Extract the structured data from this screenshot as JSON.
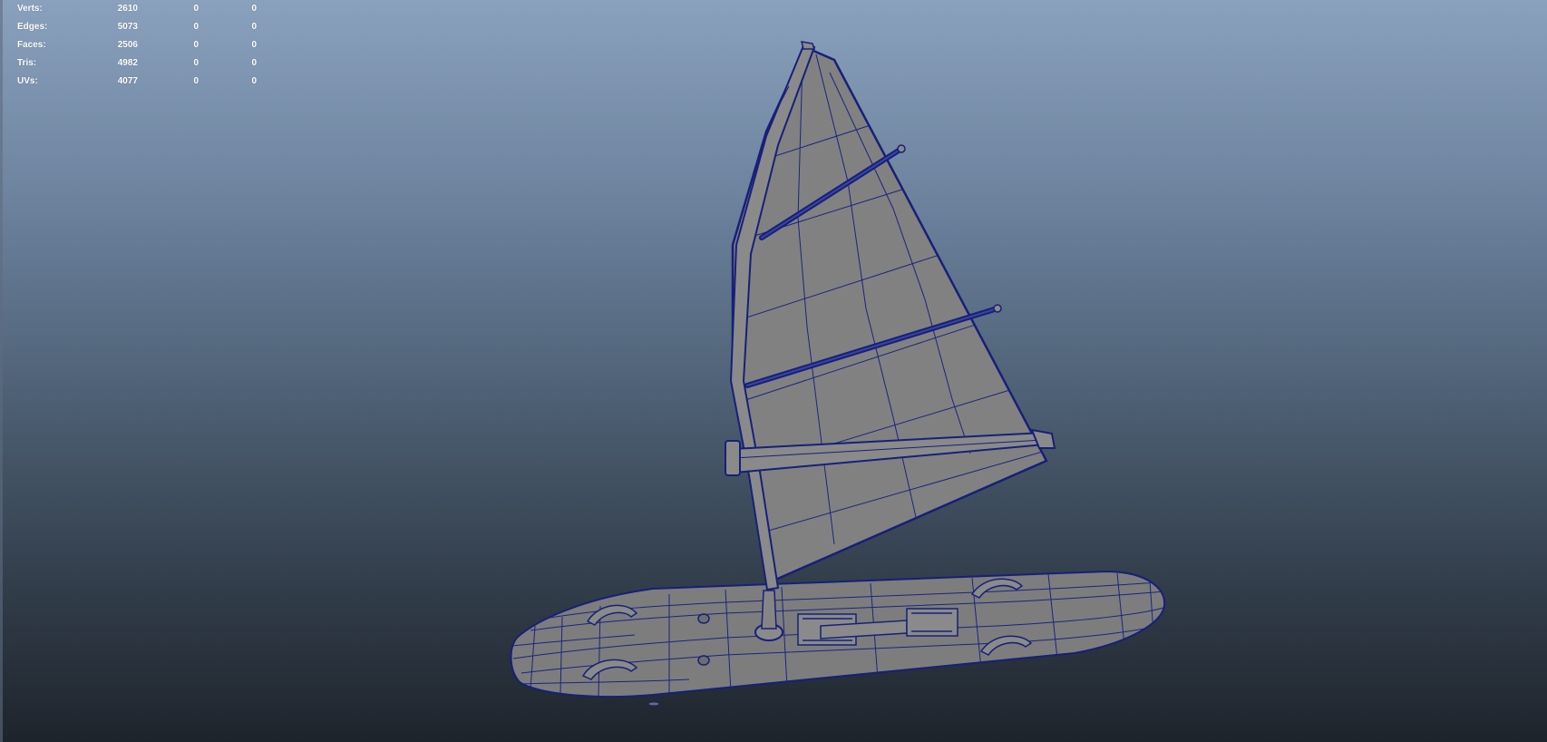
{
  "heads_up_display": {
    "poly_count": [
      {
        "label": "Verts:",
        "total": "2610",
        "selected": "0",
        "component": "0"
      },
      {
        "label": "Edges:",
        "total": "5073",
        "selected": "0",
        "component": "0"
      },
      {
        "label": "Faces:",
        "total": "2506",
        "selected": "0",
        "component": "0"
      },
      {
        "label": "Tris:",
        "total": "4982",
        "selected": "0",
        "component": "0"
      },
      {
        "label": "UVs:",
        "total": "4077",
        "selected": "0",
        "component": "0"
      }
    ]
  },
  "viewport": {
    "model": "windsurfer-board-and-sail",
    "shading": "smooth-shade-with-wireframe",
    "colors": {
      "wireframe": "#16207a",
      "surface": "#808080",
      "background_top": "#8aa1bd",
      "background_bottom": "#1e242c"
    }
  }
}
